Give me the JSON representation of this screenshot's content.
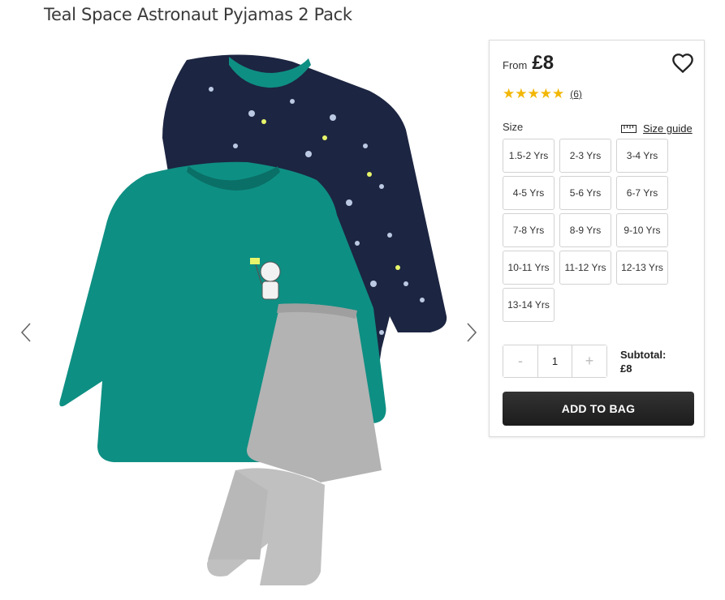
{
  "product": {
    "title": "Teal Space Astronaut Pyjamas 2 Pack"
  },
  "price": {
    "from_label": "From",
    "value": "£8"
  },
  "rating": {
    "stars": "★★★★★",
    "value": 5,
    "review_count": "(6)"
  },
  "size": {
    "label": "Size",
    "guide_label": "Size guide",
    "options": [
      "1.5-2 Yrs",
      "2-3 Yrs",
      "3-4 Yrs",
      "4-5 Yrs",
      "5-6 Yrs",
      "6-7 Yrs",
      "7-8 Yrs",
      "8-9 Yrs",
      "9-10 Yrs",
      "10-11 Yrs",
      "11-12 Yrs",
      "12-13 Yrs",
      "13-14 Yrs"
    ]
  },
  "quantity": {
    "minus": "-",
    "value": "1",
    "plus": "+"
  },
  "subtotal": {
    "label": "Subtotal:",
    "value": "£8"
  },
  "cta": {
    "add_to_bag": "ADD TO BAG"
  },
  "icons": {
    "prev": "chevron-left-icon",
    "next": "chevron-right-icon",
    "wishlist": "heart-icon",
    "ruler": "ruler-icon"
  },
  "colors": {
    "teal": "#0e8f83",
    "navy": "#1c2541",
    "grey": "#b3b3b3",
    "star": "#f2b705",
    "button": "#222222"
  }
}
